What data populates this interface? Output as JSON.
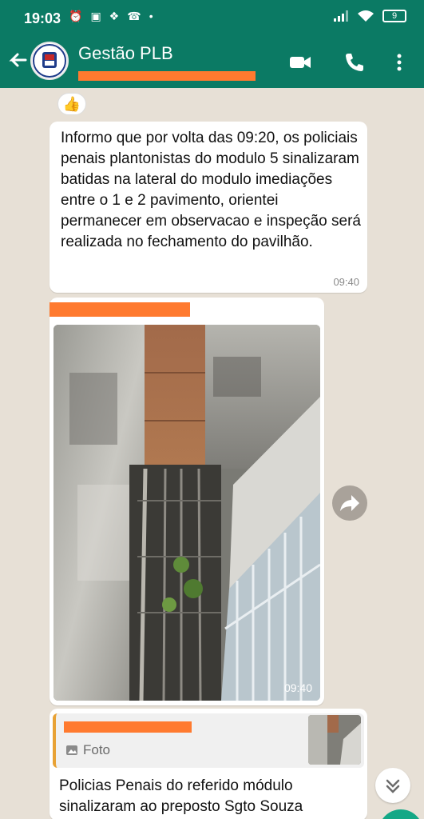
{
  "status_bar": {
    "time": "19:03",
    "battery": "9"
  },
  "header": {
    "title": "Gestão PLB",
    "subtitle": "e..."
  },
  "messages": [
    {
      "reaction": "👍",
      "text": "Informo que por volta das 09:20, os policiais penais plantonistas do modulo 5 sinalizaram batidas na lateral do modulo imediações entre o 1 e 2 pavimento, orientei permanecer em observacao e inspeção será realizada no fechamento do pavilhão.",
      "time": "09:40"
    },
    {
      "type": "image",
      "time": "09:40"
    },
    {
      "quote_label": "Foto",
      "text": "Policias Penais do referido módulo sinalizaram ao preposto Sgto Souza"
    }
  ],
  "colors": {
    "header": "#0b7a64",
    "chat_bg": "#e7e0d6",
    "quote_bar": "#e8a235",
    "redaction": "#ff7a2f"
  }
}
